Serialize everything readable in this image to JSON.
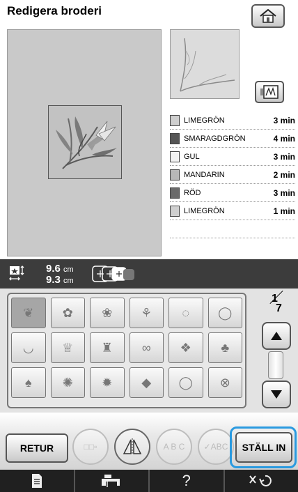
{
  "header": {
    "title": "Redigera broderi",
    "home_icon": "home-icon"
  },
  "preview": {
    "view_toggle_icon": "thread-view-icon"
  },
  "threads": [
    {
      "name": "LIMEGRÖN",
      "time": "3 min",
      "color": "#cfcfcf"
    },
    {
      "name": "SMARAGDGRÖN",
      "time": "4 min",
      "color": "#555555"
    },
    {
      "name": "GUL",
      "time": "3 min",
      "color": "#f2f2f2"
    },
    {
      "name": "MANDARIN",
      "time": "2 min",
      "color": "#b8b8b8"
    },
    {
      "name": "RÖD",
      "time": "3 min",
      "color": "#6a6a6a"
    },
    {
      "name": "LIMEGRÖN",
      "time": "1 min",
      "color": "#cfcfcf"
    }
  ],
  "size": {
    "width_value": "9.6",
    "width_unit": "cm",
    "height_value": "9.3",
    "height_unit": "cm"
  },
  "pattern_grid": {
    "selected_index": 0,
    "rows": [
      [
        "leaf-branch-pattern",
        "floral-spray-pattern",
        "flower-sprig-pattern",
        "grass-sprig-pattern",
        "vine-wreath-pattern",
        "laurel-wreath-pattern"
      ],
      [
        "floral-garland-pattern",
        "ornament-crest-pattern",
        "vase-ornament-pattern",
        "scroll-border-pattern",
        "damask-diamond-pattern",
        "damask-drop-pattern"
      ],
      [
        "filigree-drop-pattern",
        "lace-medallion-pattern",
        "damask-medallion-pattern",
        "small-diamond-pattern",
        "wreath-outline-pattern",
        "rosette-pattern"
      ]
    ]
  },
  "pager": {
    "current": "1",
    "total": "7"
  },
  "buttons": {
    "retur": "RETUR",
    "set": "STÄLL IN",
    "multi_select_label": "□□▫",
    "mirror_icon": "mirror-icon",
    "arc_text_label": "A B C",
    "check_text_label": "✓ABC"
  },
  "footer": {
    "icons": [
      "page-icon",
      "machine-icon",
      "help-icon",
      "settings-icon"
    ],
    "help_label": "?"
  },
  "colors": {
    "accent": "#2a9ae0",
    "size_bar": "#3c3c3c",
    "footer": "#202020"
  }
}
